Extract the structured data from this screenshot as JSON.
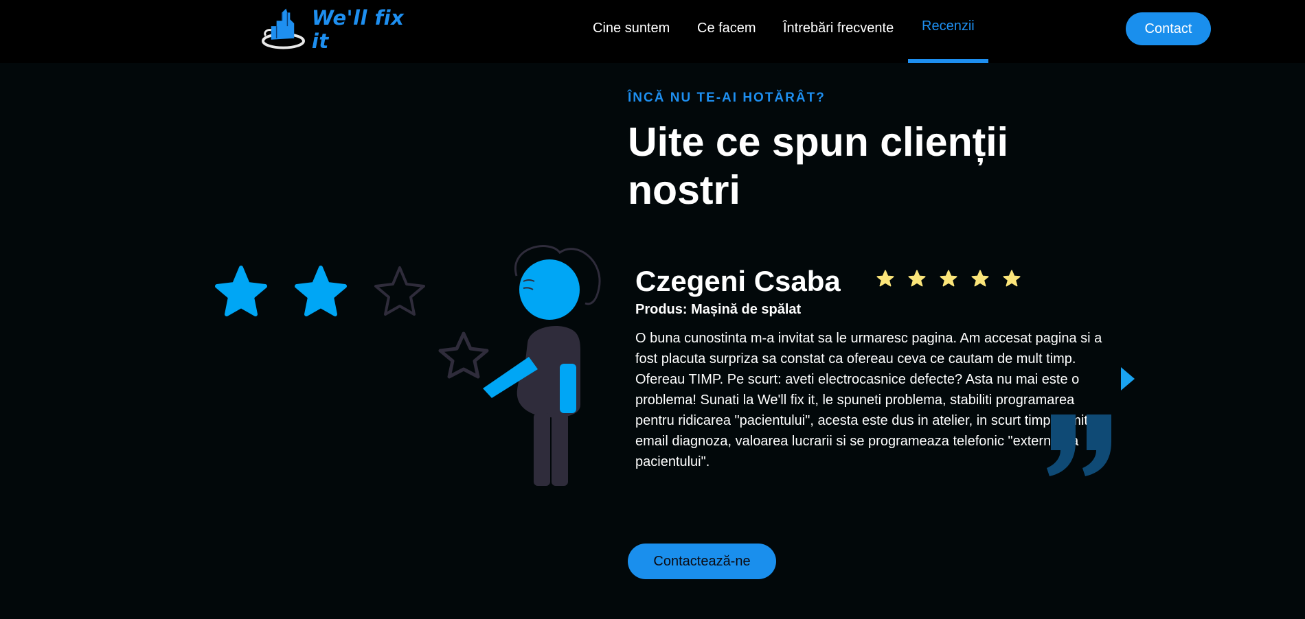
{
  "brand": {
    "logo_text": "We'll fix it"
  },
  "nav": {
    "items": [
      {
        "label": "Cine suntem"
      },
      {
        "label": "Ce facem"
      },
      {
        "label": "Întrebări frecvente"
      },
      {
        "label": "Recenzii",
        "active": true
      }
    ],
    "contact_label": "Contact"
  },
  "hero": {
    "eyebrow": "ÎNCĂ NU TE-AI HOTĂRÂT?",
    "headline": "Uite ce spun clienții nostri"
  },
  "review": {
    "name": "Czegeni Csaba",
    "rating": 5,
    "rating_max": 5,
    "product": "Produs: Mașină de spălat",
    "text": "O buna cunostinta m-a invitat sa le urmaresc pagina. Am accesat pagina si a fost placuta surpriza sa constat ca ofereau ceva ce cautam de mult timp. Ofereau TIMP. Pe scurt: aveti electrocasnice defecte? Asta nu mai este o problema! Sunati la We'll fix it, le spuneti problema, stabiliti programarea pentru ridicarea \"pacientului\", acesta este dus in atelier, in scurt timp primiti pe email diagnoza, valoarea lucrarii si se programeaza telefonic \"externarea pacientului\"."
  },
  "illustration": {
    "stars_filled": 2,
    "stars_total": 3
  },
  "cta": {
    "label": "Contactează-ne"
  },
  "colors": {
    "accent": "#1e8ff0",
    "button": "#1a8fed",
    "illustration_blue": "#00a6f5",
    "illustration_dark": "#2f2c3b",
    "rating_star": "#fbe57a",
    "background": "#02080a",
    "navbar": "#000000"
  },
  "icons": {
    "logo": "house-city-logo-icon",
    "next": "chevron-right-icon",
    "quote": "closing-quote-icon",
    "rating": "star-icon"
  }
}
